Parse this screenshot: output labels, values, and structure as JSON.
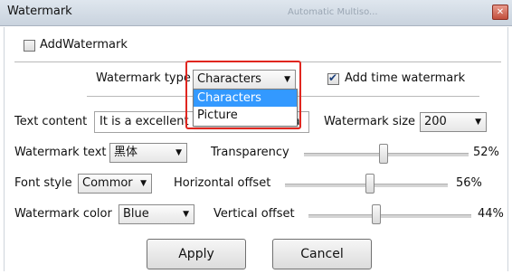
{
  "window": {
    "title": "Watermark",
    "background_title": "Automatic Multiso..."
  },
  "add_watermark": {
    "label": "AddWatermark",
    "checked": false
  },
  "watermark_type": {
    "label": "Watermark type",
    "value": "Characters",
    "options": [
      "Characters",
      "Picture"
    ],
    "selected_option": "Characters"
  },
  "add_time_watermark": {
    "label": "Add time watermark",
    "checked": true
  },
  "text_content": {
    "label": "Text content",
    "value": "It is a excellent document camera"
  },
  "watermark_size": {
    "label": "Watermark size",
    "value": "200"
  },
  "watermark_text": {
    "label": "Watermark text",
    "value": "黑体"
  },
  "transparency": {
    "label": "Transparency",
    "value_text": "52%",
    "value": 0.52
  },
  "font_style": {
    "label": "Font style",
    "value": "Commor"
  },
  "horizontal_offset": {
    "label": "Horizontal offset",
    "value_text": "56%",
    "value": 0.56
  },
  "watermark_color": {
    "label": "Watermark color",
    "value": "Blue"
  },
  "vertical_offset": {
    "label": "Vertical offset",
    "value_text": "44%",
    "value": 0.44
  },
  "buttons": {
    "apply": "Apply",
    "cancel": "Cancel"
  },
  "colors": {
    "highlight": "#e0261f",
    "selection": "#3399ff"
  }
}
